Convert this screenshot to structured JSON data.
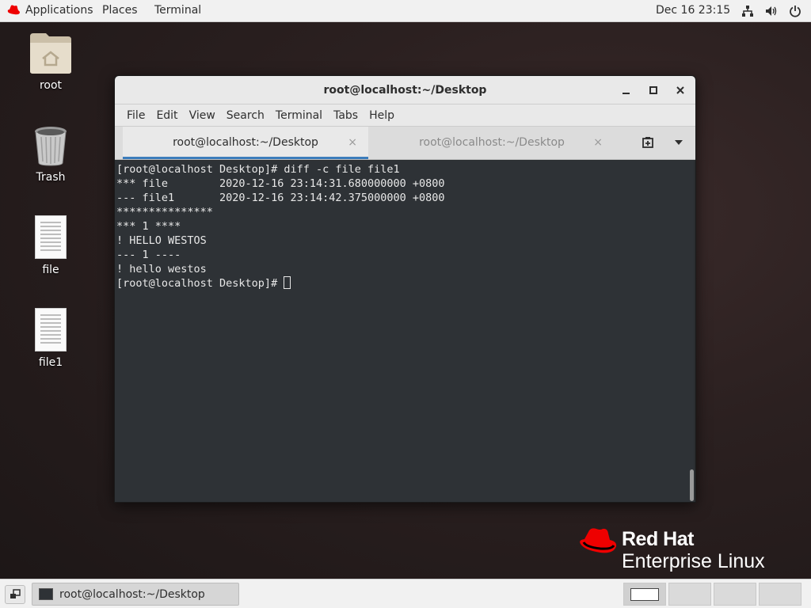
{
  "topbar": {
    "applications": "Applications",
    "places": "Places",
    "terminal": "Terminal",
    "clock": "Dec 16  23:15",
    "icons": [
      "network-icon",
      "volume-icon",
      "power-icon"
    ]
  },
  "desktop": {
    "icons": [
      {
        "label": "root",
        "kind": "home-folder-icon"
      },
      {
        "label": "Trash",
        "kind": "trash-icon"
      },
      {
        "label": "file",
        "kind": "text-file-icon"
      },
      {
        "label": "file1",
        "kind": "text-file-icon"
      }
    ]
  },
  "window": {
    "title": "root@localhost:~/Desktop",
    "menu": [
      "File",
      "Edit",
      "View",
      "Search",
      "Terminal",
      "Tabs",
      "Help"
    ],
    "tabs": [
      {
        "label": "root@localhost:~/Desktop",
        "active": true
      },
      {
        "label": "root@localhost:~/Desktop",
        "active": false
      }
    ],
    "tab_close_glyph": "×",
    "terminal_lines": [
      "[root@localhost Desktop]# diff -c file file1",
      "*** file        2020-12-16 23:14:31.680000000 +0800",
      "--- file1       2020-12-16 23:14:42.375000000 +0800",
      "***************",
      "*** 1 ****",
      "! HELLO WESTOS",
      "--- 1 ----",
      "! hello westos"
    ],
    "prompt": "[root@localhost Desktop]# "
  },
  "branding": {
    "brand": "Red Hat",
    "product": "Enterprise Linux",
    "colors": {
      "logo_red": "#ee0000"
    }
  },
  "taskbar": {
    "task_label": "root@localhost:~/Desktop",
    "workspace_count": 4,
    "active_workspace": 1
  },
  "colors": {
    "accent": "#3c7dbb",
    "terminal_bg": "#2e3236"
  }
}
